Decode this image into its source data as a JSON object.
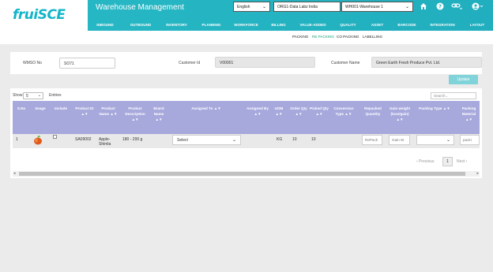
{
  "header": {
    "logo": "fruiSCE",
    "app_title": "Warehouse Management",
    "language": "English",
    "organization": "ORG1-Data Labz India",
    "warehouse": "WH001-Warehouse 1"
  },
  "nav": [
    "INBOUND",
    "OUTBOUND",
    "INVENTORY",
    "PLANNING",
    "WORKFORCE",
    "BILLING",
    "VALUE-ADDED",
    "QUALITY",
    "ASSET",
    "BARCODE",
    "INTEGRATION",
    "LAYOUT"
  ],
  "subnav": [
    "PACKING",
    "RE PACKING",
    "CO PACKING",
    "LABELLING"
  ],
  "form": {
    "wmso_label": "WMSO No",
    "wmso_value": "SO71",
    "customer_id_label": "Customer Id",
    "customer_id_value": "V00001",
    "customer_name_label": "Customer Name",
    "customer_name_value": "Green Earth Fresh Produce Pvt. Ltd.",
    "update_label": "Update"
  },
  "table": {
    "show_label": "Show",
    "show_value": "5",
    "entries_label": "Entries",
    "search_placeholder": "Search...",
    "columns": {
      "sno": "S.No",
      "image": "Image",
      "include": "Include",
      "product_id": "Product ID",
      "product_name": "Product Name",
      "product_desc": "Product Description",
      "brand_name": "Brand Name",
      "assigned_to": "Assigned To",
      "assigned_by": "Assigned By",
      "uom": "UOM",
      "order_qty": "Order Qty",
      "picked_qty": "Picked Qty",
      "conversion_type": "Conversion Type",
      "repacked_qty": "Repacked Quantity",
      "gain_weight": "Gain weight (loss/gain)",
      "packing_type": "Packing Type",
      "packing_material": "Packing Material"
    },
    "sort_glyph": "▲▼",
    "row": {
      "sno": "1",
      "product_id": "SA09002",
      "product_name": "Apple-Shimla",
      "product_desc": "180 - 200 g",
      "assigned_to": "Select",
      "uom": "KG",
      "order_qty": "10",
      "picked_qty": "10",
      "repacked_placeholder": "RePack",
      "gain_placeholder": "Gain W",
      "packing_material_placeholder": "packi"
    },
    "pager": {
      "previous": "Previous",
      "page": "1",
      "next": "Next"
    }
  },
  "colors": {
    "brand": "#12b5c9",
    "header": "#26b7c4",
    "table_header": "#a7a8dc",
    "active_subnav": "#18a37b",
    "update_button": "#7fd3d9"
  }
}
